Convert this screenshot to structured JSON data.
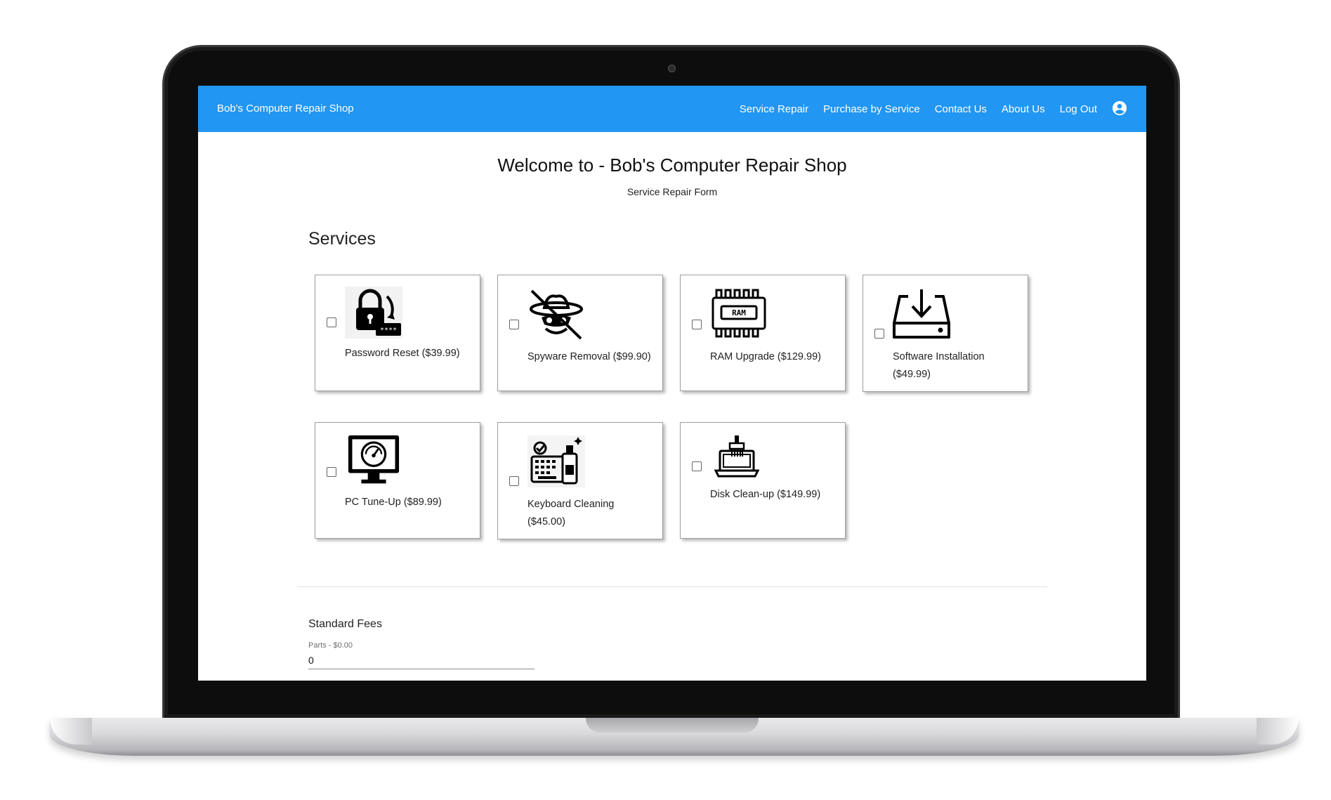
{
  "app": {
    "brand": "Bob's Computer Repair Shop",
    "accent_color": "#2196f3"
  },
  "nav": {
    "items": [
      {
        "label": "Service Repair"
      },
      {
        "label": "Purchase by Service"
      },
      {
        "label": "Contact Us"
      },
      {
        "label": "About Us"
      },
      {
        "label": "Log Out"
      }
    ],
    "account_icon": "account-circle-icon"
  },
  "page": {
    "welcome": "Welcome to - Bob's Computer Repair Shop",
    "subtitle": "Service Repair Form"
  },
  "services": {
    "heading": "Services",
    "items": [
      {
        "name": "Password Reset",
        "price": "($39.99)",
        "label": "Password Reset ($39.99)",
        "checked": false,
        "icon": "password-reset-icon"
      },
      {
        "name": "Spyware Removal",
        "price": "($99.90)",
        "label": "Spyware Removal ($99.90)",
        "checked": false,
        "icon": "spyware-icon"
      },
      {
        "name": "RAM Upgrade",
        "price": "($129.99)",
        "label": "RAM Upgrade ($129.99)",
        "checked": false,
        "icon": "ram-chip-icon",
        "icon_text": "RAM"
      },
      {
        "name": "Software Installation",
        "price": "($49.99)",
        "label_line1": "Software Installation",
        "label_line2": "($49.99)",
        "checked": false,
        "icon": "download-drive-icon"
      },
      {
        "name": "PC Tune-Up",
        "price": "($89.99)",
        "label": "PC Tune-Up ($89.99)",
        "checked": false,
        "icon": "monitor-gauge-icon"
      },
      {
        "name": "Keyboard Cleaning",
        "price": "($45.00)",
        "label_line1": "Keyboard Cleaning",
        "label_line2": "($45.00)",
        "checked": false,
        "icon": "keyboard-cleaning-icon"
      },
      {
        "name": "Disk Clean-up",
        "price": "($149.99)",
        "label": "Disk Clean-up ($149.99)",
        "checked": false,
        "icon": "laptop-brush-icon"
      }
    ]
  },
  "fees": {
    "heading": "Standard Fees",
    "parts_label": "Parts - $0.00",
    "parts_value": "0"
  }
}
